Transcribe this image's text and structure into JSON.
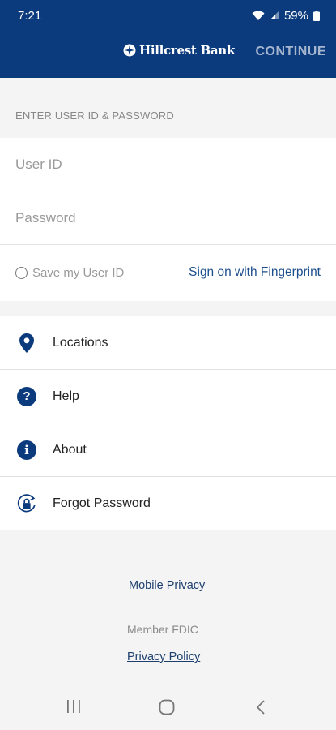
{
  "status_bar": {
    "time": "7:21",
    "battery": "59%"
  },
  "header": {
    "brand": "Hillcrest Bank",
    "continue_label": "CONTINUE"
  },
  "login": {
    "section_label": "ENTER USER ID & PASSWORD",
    "user_id_placeholder": "User ID",
    "password_placeholder": "Password",
    "save_user_id_label": "Save my User ID",
    "fingerprint_label": "Sign on with Fingerprint"
  },
  "menu": {
    "items": [
      {
        "label": "Locations",
        "icon": "location-pin-icon"
      },
      {
        "label": "Help",
        "icon": "help-icon"
      },
      {
        "label": "About",
        "icon": "info-icon"
      },
      {
        "label": "Forgot Password",
        "icon": "lock-reset-icon"
      }
    ]
  },
  "footer": {
    "mobile_privacy": "Mobile Privacy",
    "member_fdic": "Member FDIC",
    "privacy_policy": "Privacy Policy"
  },
  "colors": {
    "brand_navy": "#0b3a7d",
    "link_blue": "#1c4e8c"
  }
}
